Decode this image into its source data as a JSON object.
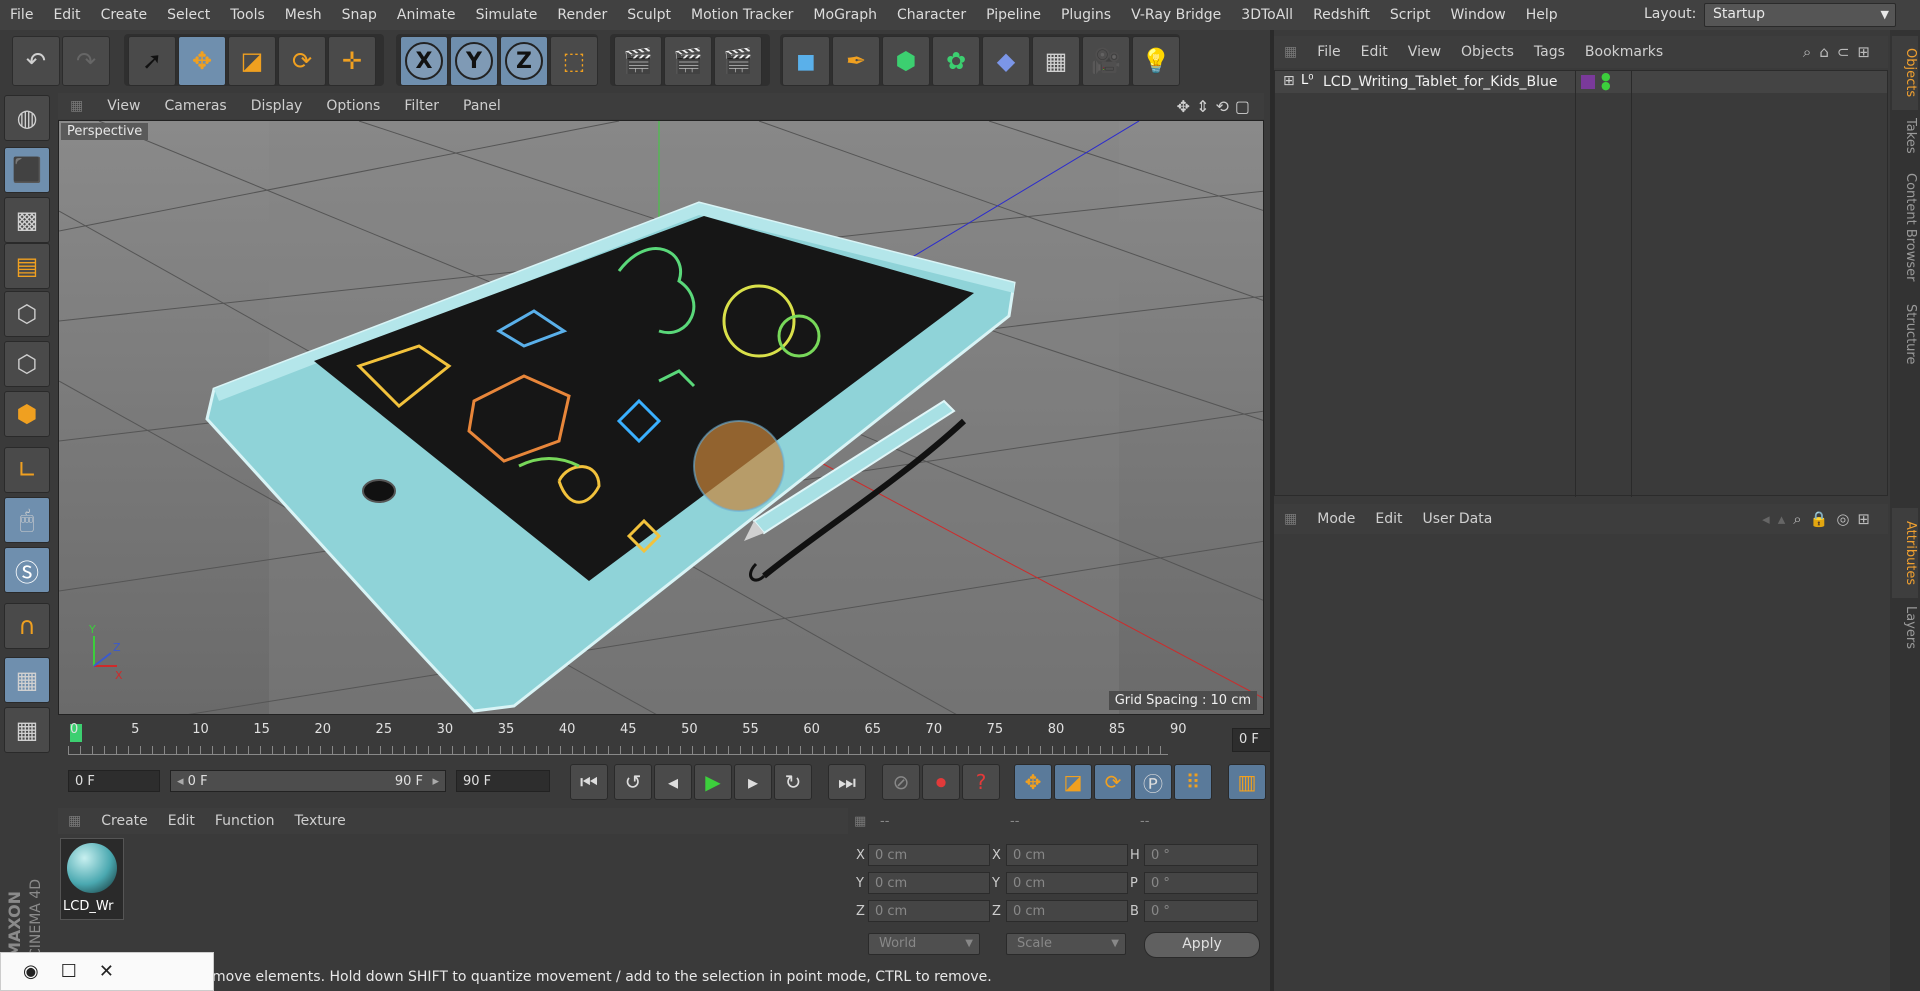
{
  "menubar": {
    "items": [
      "File",
      "Edit",
      "Create",
      "Select",
      "Tools",
      "Mesh",
      "Snap",
      "Animate",
      "Simulate",
      "Render",
      "Sculpt",
      "Motion Tracker",
      "MoGraph",
      "Character",
      "Pipeline",
      "Plugins",
      "V-Ray Bridge",
      "3DToAll",
      "Redshift",
      "Script",
      "Window",
      "Help"
    ],
    "layout_label": "Layout:",
    "layout_value": "Startup"
  },
  "toolbar": {
    "axis_x": "X",
    "axis_y": "Y",
    "axis_z": "Z"
  },
  "viewport": {
    "menu": [
      "View",
      "Cameras",
      "Display",
      "Options",
      "Filter",
      "Panel"
    ],
    "label": "Perspective",
    "grid_spacing": "Grid Spacing : 10 cm"
  },
  "timeline": {
    "ticks": [
      "0",
      "5",
      "10",
      "15",
      "20",
      "25",
      "30",
      "35",
      "40",
      "45",
      "50",
      "55",
      "60",
      "65",
      "70",
      "75",
      "80",
      "85",
      "90"
    ],
    "current_frame": "0 F"
  },
  "transport": {
    "start": "0 F",
    "range_start": "0 F",
    "range_end": "90 F",
    "end": "90 F"
  },
  "material_manager": {
    "menu": [
      "Create",
      "Edit",
      "Function",
      "Texture"
    ],
    "material_name": "LCD_Wr"
  },
  "coordinates": {
    "headers": [
      "--",
      "--",
      "--"
    ],
    "pos_labels": [
      "X",
      "Y",
      "Z"
    ],
    "size_labels": [
      "X",
      "Y",
      "Z"
    ],
    "rot_labels": [
      "H",
      "P",
      "B"
    ],
    "pos_values": [
      "0 cm",
      "0 cm",
      "0 cm"
    ],
    "size_values": [
      "0 cm",
      "0 cm",
      "0 cm"
    ],
    "rot_values": [
      "0 °",
      "0 °",
      "0 °"
    ],
    "world_label": "World",
    "scale_label": "Scale",
    "apply_label": "Apply"
  },
  "status": {
    "text": "move elements. Hold down SHIFT to quantize movement / add to the selection in point mode, CTRL to remove."
  },
  "objects_panel": {
    "menu": [
      "File",
      "Edit",
      "View",
      "Objects",
      "Tags",
      "Bookmarks"
    ],
    "object_name": "LCD_Writing_Tablet_for_Kids_Blue"
  },
  "attributes_panel": {
    "menu": [
      "Mode",
      "Edit",
      "User Data"
    ]
  },
  "side_tabs": [
    "Objects",
    "Takes",
    "Content Browser",
    "Structure",
    "Attributes",
    "Layers"
  ],
  "logo": {
    "brand": "MAXON",
    "product": "CINEMA 4D"
  },
  "colors": {
    "accent": "#6f8fae",
    "tab_active": "#f0a030",
    "tablet": "#8fd3d8"
  }
}
